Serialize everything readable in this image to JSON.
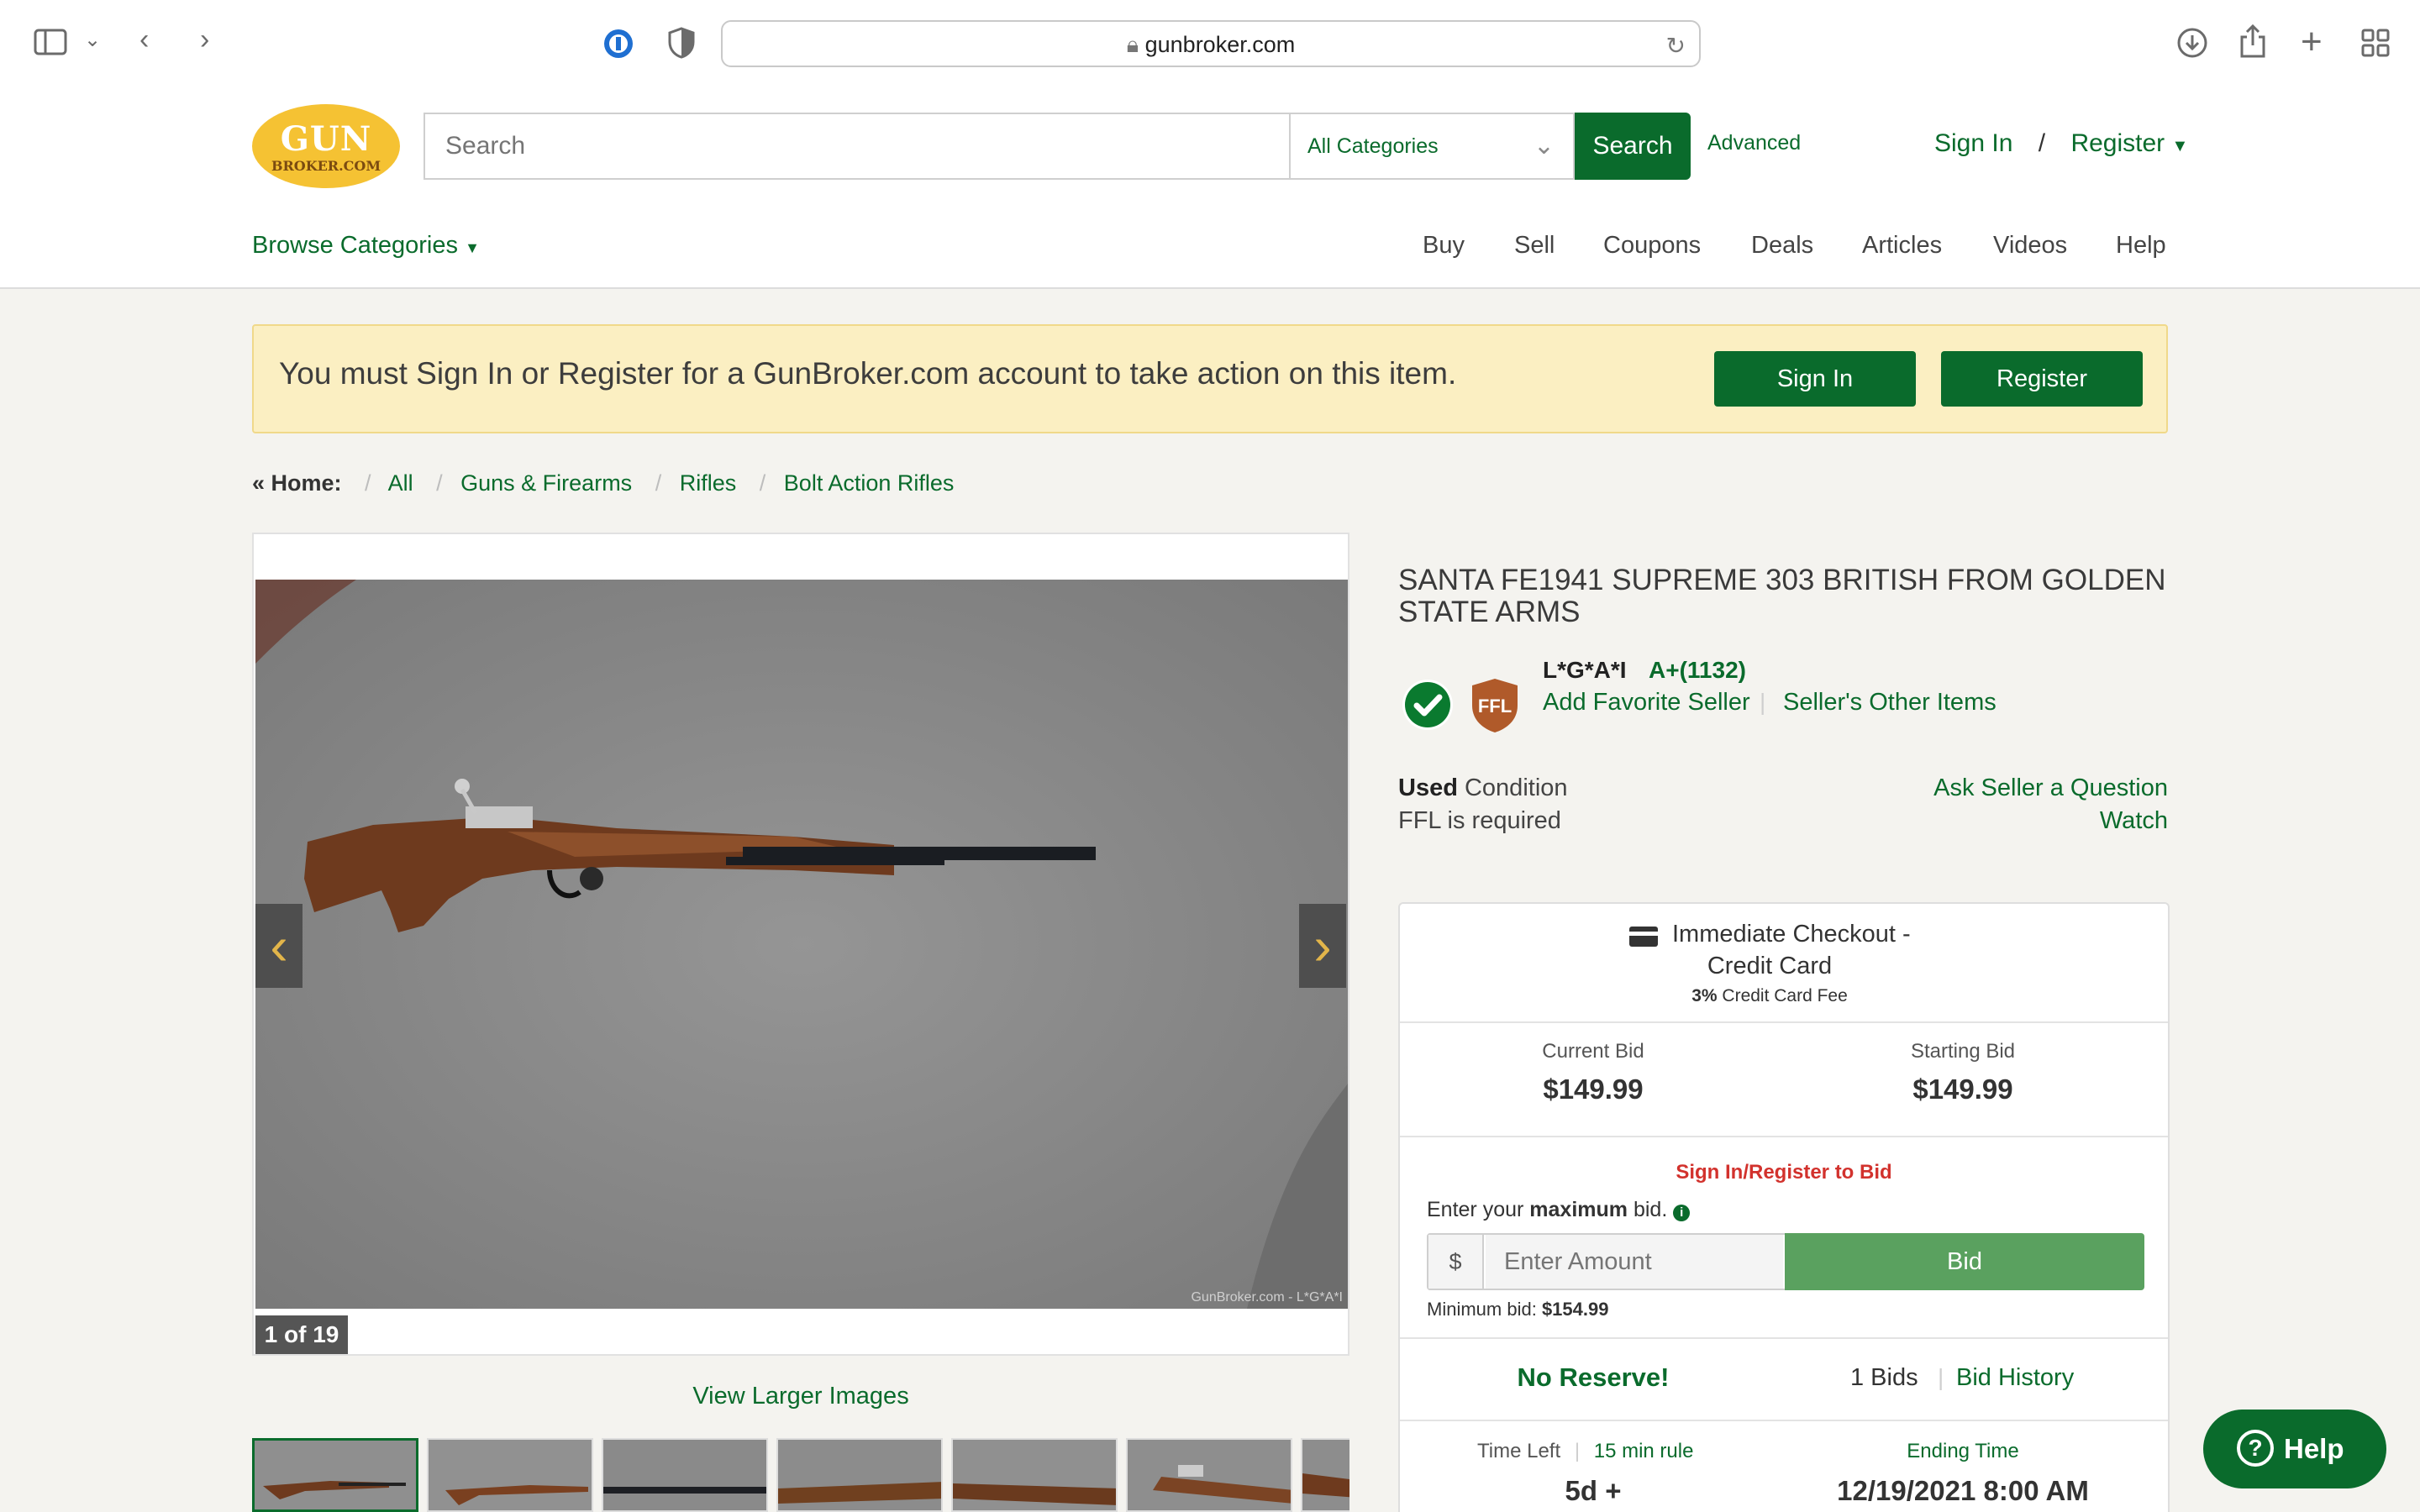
{
  "browser": {
    "url": "gunbroker.com"
  },
  "header": {
    "logo_line1": "GUN",
    "logo_line2": "BROKER.COM",
    "search_placeholder": "Search",
    "category": "All Categories",
    "search_button": "Search",
    "advanced": "Advanced",
    "sign_in": "Sign In",
    "slash": "/",
    "register": "Register",
    "browse_categories": "Browse Categories",
    "nav": [
      "Buy",
      "Sell",
      "Coupons",
      "Deals",
      "Articles",
      "Videos",
      "Help"
    ]
  },
  "alert": {
    "message": "You must Sign In or Register for a GunBroker.com account to take action on this item.",
    "sign_in": "Sign In",
    "register": "Register"
  },
  "breadcrumb": {
    "home": "« Home:",
    "items": [
      "All",
      "Guns & Firearms",
      "Rifles",
      "Bolt Action Rifles"
    ]
  },
  "gallery": {
    "counter": "1 of 19",
    "watermark": "GunBroker.com - L*G*A*I",
    "view_larger": "View Larger Images"
  },
  "listing": {
    "title": "SANTA FE1941 SUPREME 303 BRITISH FROM GOLDEN STATE ARMS",
    "ffl_badge": "FFL",
    "seller_name": "L*G*A*I",
    "seller_rating": "A+(1132)",
    "add_favorite": "Add Favorite Seller",
    "other_items": "Seller's Other Items",
    "condition_strong": "Used",
    "condition_label": "Condition",
    "ffl_required": "FFL is required",
    "ask_seller": "Ask Seller a Question",
    "watch": "Watch"
  },
  "bid_panel": {
    "checkout_line1": "Immediate Checkout -",
    "checkout_line2": "Credit Card",
    "fee_strong": "3%",
    "fee_text": "Credit Card Fee",
    "current_bid_label": "Current Bid",
    "current_bid": "$149.99",
    "starting_bid_label": "Starting Bid",
    "starting_bid": "$149.99",
    "signin_to_bid": "Sign In/Register to Bid",
    "enter_prefix": "Enter your",
    "enter_strong": "maximum",
    "enter_suffix": "bid.",
    "currency": "$",
    "amount_placeholder": "Enter Amount",
    "bid_button": "Bid",
    "min_bid_label": "Minimum bid:",
    "min_bid": "$154.99",
    "no_reserve": "No Reserve!",
    "bids_count": "1 Bids",
    "bid_history": "Bid History",
    "time_left_label": "Time Left",
    "rule": "15 min rule",
    "time_left": "5d +",
    "ending_time_label": "Ending Time",
    "ending_time": "12/19/2021 8:00 AM"
  },
  "help_widget": {
    "label": "Help"
  }
}
